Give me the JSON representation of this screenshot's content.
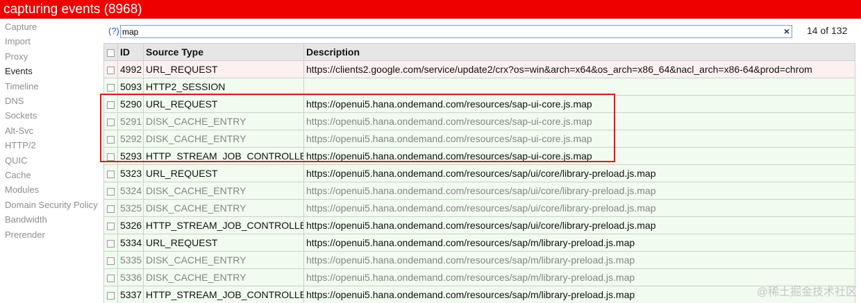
{
  "header": {
    "title": "capturing events (8968)"
  },
  "sidebar": {
    "items": [
      {
        "label": "Capture",
        "active": false
      },
      {
        "label": "Import",
        "active": false
      },
      {
        "label": "Proxy",
        "active": false
      },
      {
        "label": "Events",
        "active": true
      },
      {
        "label": "Timeline",
        "active": false
      },
      {
        "label": "DNS",
        "active": false
      },
      {
        "label": "Sockets",
        "active": false
      },
      {
        "label": "Alt-Svc",
        "active": false
      },
      {
        "label": "HTTP/2",
        "active": false
      },
      {
        "label": "QUIC",
        "active": false
      },
      {
        "label": "Cache",
        "active": false
      },
      {
        "label": "Modules",
        "active": false
      },
      {
        "label": "Domain Security Policy",
        "active": false
      },
      {
        "label": "Bandwidth",
        "active": false
      },
      {
        "label": "Prerender",
        "active": false
      }
    ]
  },
  "filter": {
    "help_label": "(?)",
    "value": "map",
    "clear_glyph": "×",
    "match_count": "14 of 132"
  },
  "table": {
    "columns": [
      "ID",
      "Source Type",
      "Description"
    ],
    "rows": [
      {
        "id": "4992",
        "type": "URL_REQUEST",
        "desc": "https://clients2.google.com/service/update2/crx?os=win&arch=x64&os_arch=x86_64&nacl_arch=x86-64&prod=chrom",
        "style": "pink",
        "tone": "dark"
      },
      {
        "id": "5093",
        "type": "HTTP2_SESSION",
        "desc": "",
        "style": "green",
        "tone": "dark"
      },
      {
        "id": "5290",
        "type": "URL_REQUEST",
        "desc": "https://openui5.hana.ondemand.com/resources/sap-ui-core.js.map",
        "style": "green",
        "tone": "dark"
      },
      {
        "id": "5291",
        "type": "DISK_CACHE_ENTRY",
        "desc": "https://openui5.hana.ondemand.com/resources/sap-ui-core.js.map",
        "style": "green",
        "tone": "muted"
      },
      {
        "id": "5292",
        "type": "DISK_CACHE_ENTRY",
        "desc": "https://openui5.hana.ondemand.com/resources/sap-ui-core.js.map",
        "style": "green",
        "tone": "muted"
      },
      {
        "id": "5293",
        "type": "HTTP_STREAM_JOB_CONTROLLER",
        "desc": "https://openui5.hana.ondemand.com/resources/sap-ui-core.js.map",
        "style": "green",
        "tone": "dark"
      },
      {
        "id": "5323",
        "type": "URL_REQUEST",
        "desc": "https://openui5.hana.ondemand.com/resources/sap/ui/core/library-preload.js.map",
        "style": "green",
        "tone": "dark"
      },
      {
        "id": "5324",
        "type": "DISK_CACHE_ENTRY",
        "desc": "https://openui5.hana.ondemand.com/resources/sap/ui/core/library-preload.js.map",
        "style": "green",
        "tone": "muted"
      },
      {
        "id": "5325",
        "type": "DISK_CACHE_ENTRY",
        "desc": "https://openui5.hana.ondemand.com/resources/sap/ui/core/library-preload.js.map",
        "style": "green",
        "tone": "muted"
      },
      {
        "id": "5326",
        "type": "HTTP_STREAM_JOB_CONTROLLER",
        "desc": "https://openui5.hana.ondemand.com/resources/sap/ui/core/library-preload.js.map",
        "style": "green",
        "tone": "dark"
      },
      {
        "id": "5334",
        "type": "URL_REQUEST",
        "desc": "https://openui5.hana.ondemand.com/resources/sap/m/library-preload.js.map",
        "style": "green",
        "tone": "dark"
      },
      {
        "id": "5335",
        "type": "DISK_CACHE_ENTRY",
        "desc": "https://openui5.hana.ondemand.com/resources/sap/m/library-preload.js.map",
        "style": "green",
        "tone": "muted"
      },
      {
        "id": "5336",
        "type": "DISK_CACHE_ENTRY",
        "desc": "https://openui5.hana.ondemand.com/resources/sap/m/library-preload.js.map",
        "style": "green",
        "tone": "muted"
      },
      {
        "id": "5337",
        "type": "HTTP_STREAM_JOB_CONTROLLER",
        "desc": "https://openui5.hana.ondemand.com/resources/sap/m/library-preload.js.map",
        "style": "green",
        "tone": "dark"
      }
    ]
  },
  "watermark": "@稀土掘金技术社区",
  "colors": {
    "topbar": "#ef0000",
    "highlight_border": "#d21f1f",
    "row_green": "#f1fbef",
    "row_pink": "#fdf0f0"
  }
}
